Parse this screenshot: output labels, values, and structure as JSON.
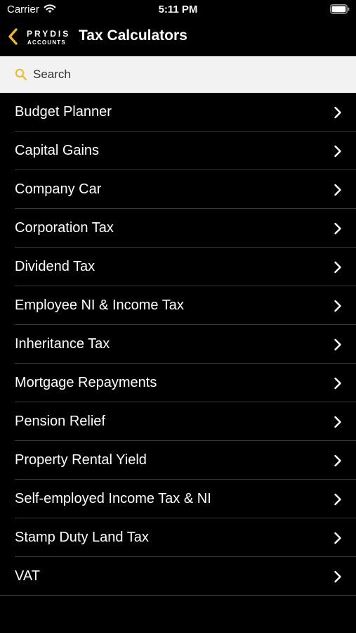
{
  "status_bar": {
    "carrier": "Carrier",
    "time": "5:11 PM",
    "icons": [
      "wifi-icon",
      "battery-icon"
    ]
  },
  "nav_bar": {
    "back_icon": "chevron-left-icon",
    "logo": {
      "brand": "PRYDIS",
      "sub": "ACCOUNTS"
    },
    "title": "Tax Calculators",
    "accent_color": "#f5b51c"
  },
  "search": {
    "placeholder": "Search",
    "icon": "search-icon"
  },
  "list": {
    "items": [
      {
        "label": "Budget Planner"
      },
      {
        "label": "Capital Gains"
      },
      {
        "label": "Company Car"
      },
      {
        "label": "Corporation Tax"
      },
      {
        "label": "Dividend Tax"
      },
      {
        "label": "Employee NI & Income Tax"
      },
      {
        "label": "Inheritance Tax"
      },
      {
        "label": "Mortgage Repayments"
      },
      {
        "label": "Pension Relief"
      },
      {
        "label": "Property Rental Yield"
      },
      {
        "label": "Self-employed Income Tax & NI"
      },
      {
        "label": "Stamp Duty Land Tax"
      },
      {
        "label": "VAT"
      }
    ],
    "row_icon": "chevron-right-icon"
  }
}
